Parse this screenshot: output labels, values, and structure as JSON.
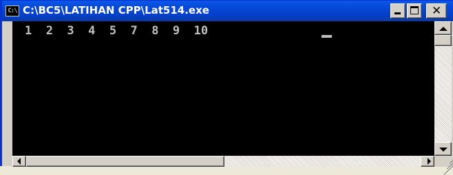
{
  "window": {
    "title": "C:\\BC5\\LATIHAN CPP\\Lat514.exe",
    "icon": "console-app-icon",
    "icon_label": "C:\\"
  },
  "controls": {
    "minimize": "minimize-icon",
    "maximize": "maximize-icon",
    "close_glyph": "✕",
    "close": "close-icon"
  },
  "console": {
    "output": "1  2  3  4  5  7  8  9  10 ",
    "background": "#000000",
    "foreground": "#c0c0c0"
  },
  "scrollbars": {
    "vertical_position": 0,
    "horizontal_position": 0
  },
  "colors": {
    "titlebar": "#0648d8",
    "chrome": "#d4d0c8"
  }
}
